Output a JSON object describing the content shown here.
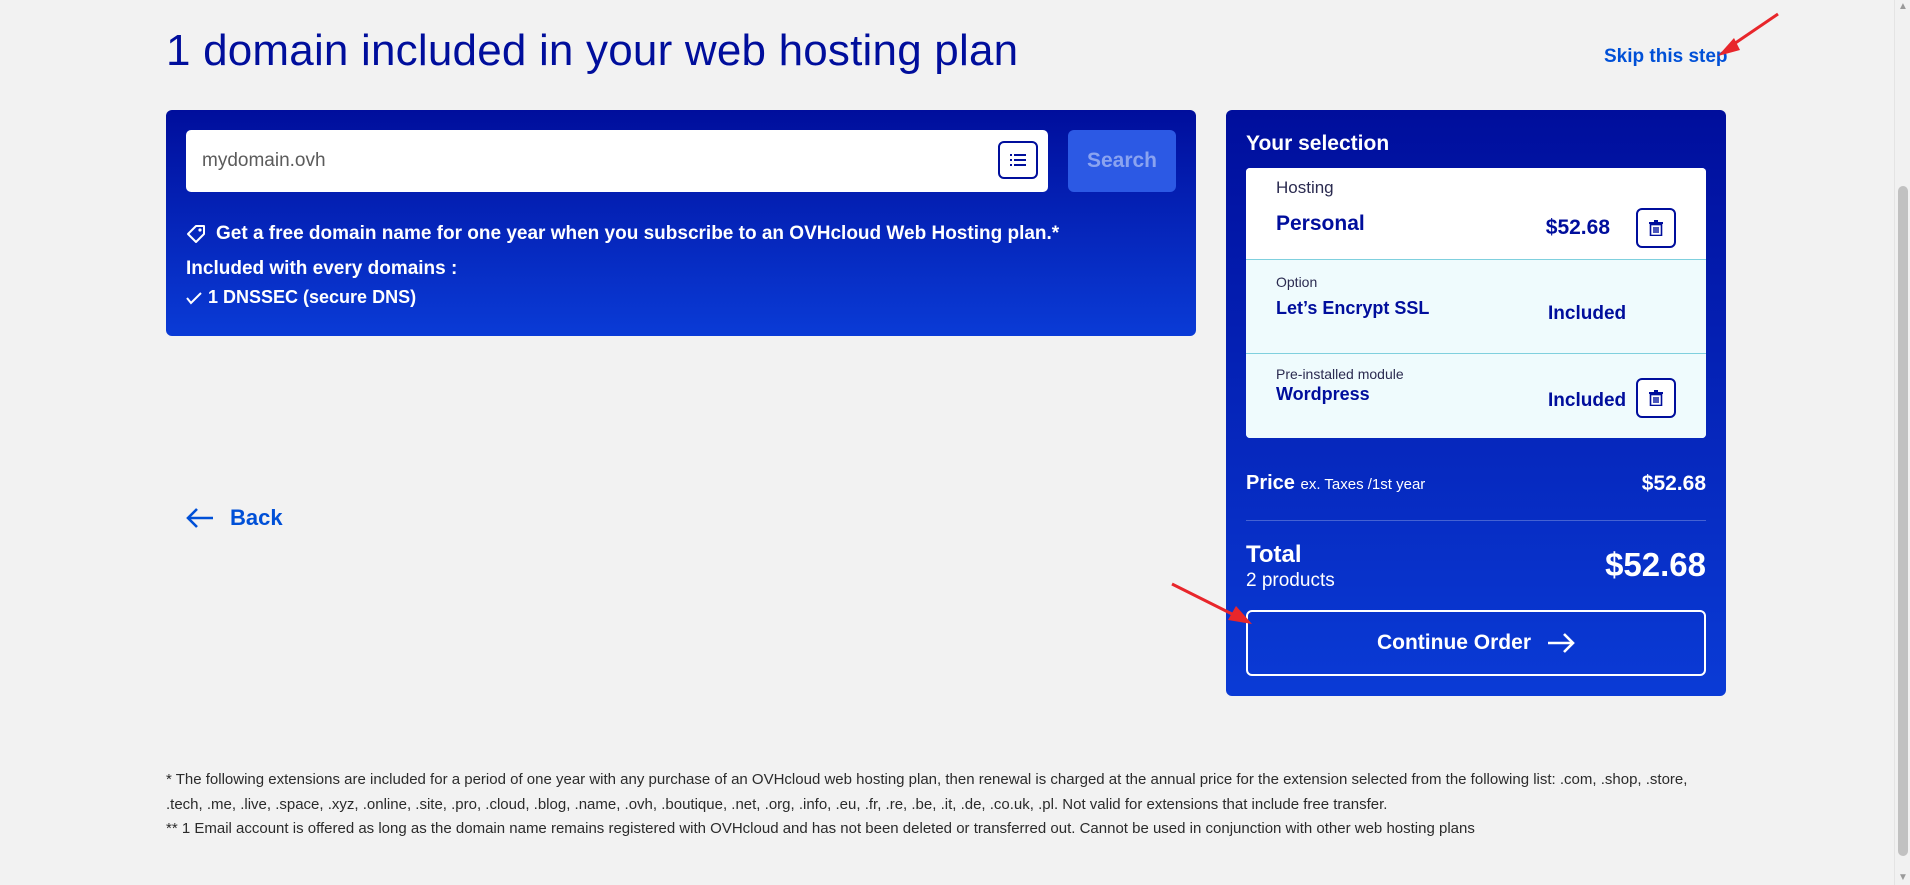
{
  "page": {
    "title": "1 domain included in your web hosting plan",
    "skip_label": "Skip this step"
  },
  "search": {
    "placeholder": "mydomain.ovh",
    "button_label": "Search",
    "promo_text": "Get a free domain name for one year when you subscribe to an OVHcloud Web Hosting plan.*",
    "included_title": "Included with every domains :",
    "included_items": [
      "1 DNSSEC (secure DNS)"
    ]
  },
  "nav": {
    "back_label": "Back"
  },
  "selection": {
    "title": "Your selection",
    "items": [
      {
        "category": "Hosting",
        "name": "Personal",
        "price": "$52.68"
      },
      {
        "category": "Option",
        "name": "Let’s Encrypt SSL",
        "price": "Included"
      },
      {
        "category": "Pre-installed module",
        "name": "Wordpress",
        "price": "Included"
      }
    ],
    "price_label": "Price",
    "price_sublabel": "ex. Taxes /1st year",
    "price_value": "$52.68",
    "total_label": "Total",
    "total_sub": "2 products",
    "total_value": "$52.68",
    "continue_label": "Continue Order"
  },
  "footnotes": {
    "line1": "* The following extensions are included for a period of one year with any purchase of an OVHcloud web hosting plan, then renewal is charged at the annual price for the extension selected from the following list: .com, .shop, .store, .tech, .me, .live, .space, .xyz, .online, .site, .pro, .cloud, .blog, .name, .ovh, .boutique, .net, .org, .info, .eu, .fr, .re, .be, .it, .de, .co.uk, .pl. Not valid for extensions that include free transfer.",
    "line2": "** 1 Email account is offered as long as the domain name remains registered with OVHcloud and has not been deleted or transferred out. Cannot be used in conjunction with other web hosting plans"
  },
  "colors": {
    "primary": "#000e9c",
    "link": "#0050d7",
    "panel_gradient_end": "#0a3bd6",
    "annotation_arrow": "#e8262b"
  },
  "icons": [
    "list-icon",
    "tag-icon",
    "check-icon",
    "arrow-left-icon",
    "trash-icon",
    "arrow-right-icon"
  ]
}
